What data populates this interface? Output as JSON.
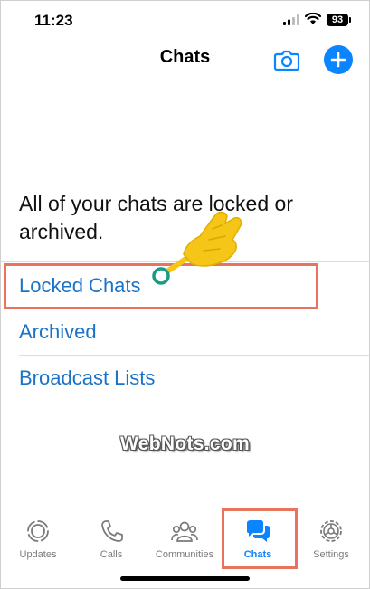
{
  "status_bar": {
    "time": "11:23",
    "battery": "93"
  },
  "header": {
    "title": "Chats"
  },
  "main": {
    "message": "All of your chats are locked or archived.",
    "links": [
      {
        "label": "Locked Chats"
      },
      {
        "label": "Archived"
      },
      {
        "label": "Broadcast Lists"
      }
    ]
  },
  "watermark": "WebNots.com",
  "tabs": [
    {
      "label": "Updates",
      "icon": "updates-icon"
    },
    {
      "label": "Calls",
      "icon": "phone-icon"
    },
    {
      "label": "Communities",
      "icon": "communities-icon"
    },
    {
      "label": "Chats",
      "icon": "chats-icon",
      "active": true
    },
    {
      "label": "Settings",
      "icon": "gear-icon"
    }
  ],
  "colors": {
    "accent": "#0b84ff",
    "link": "#1a73c9",
    "highlight": "#e8735f",
    "pointer": "#f5c518"
  }
}
